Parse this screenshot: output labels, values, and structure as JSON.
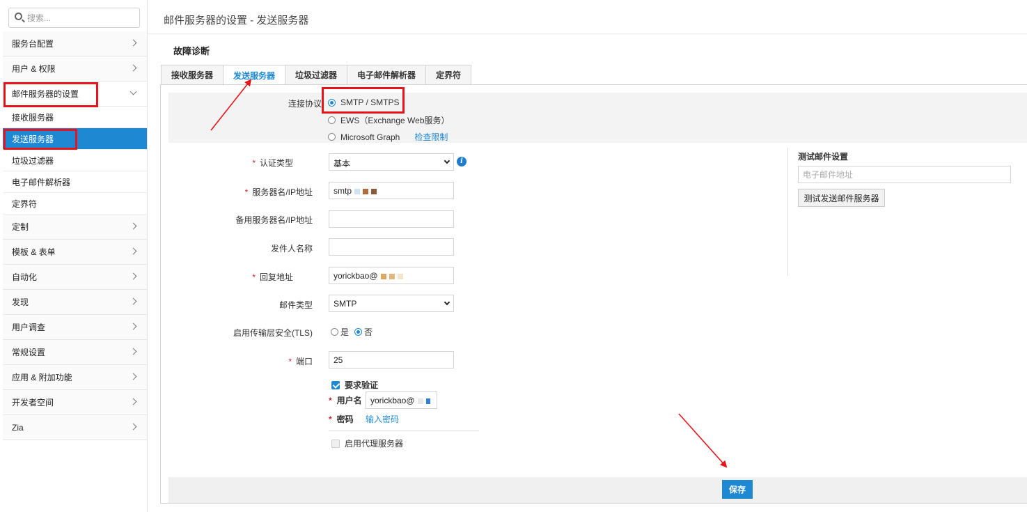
{
  "search": {
    "placeholder": "搜索..."
  },
  "sidebar": {
    "items_top": [
      {
        "label": "服务台配置"
      },
      {
        "label": "用户 & 权限"
      }
    ],
    "expanded": {
      "label": "邮件服务器的设置"
    },
    "sub_items": [
      {
        "label": "接收服务器"
      },
      {
        "label": "发送服务器"
      },
      {
        "label": "垃圾过滤器"
      },
      {
        "label": "电子邮件解析器"
      },
      {
        "label": "定界符"
      }
    ],
    "items_bottom": [
      {
        "label": "定制"
      },
      {
        "label": "模板 & 表单"
      },
      {
        "label": "自动化"
      },
      {
        "label": "发现"
      },
      {
        "label": "用户调查"
      },
      {
        "label": "常规设置"
      },
      {
        "label": "应用 & 附加功能"
      },
      {
        "label": "开发者空间"
      },
      {
        "label": "Zia"
      }
    ]
  },
  "header": {
    "title": "邮件服务器的设置 - 发送服务器"
  },
  "diagnostics": {
    "label": "故障诊断"
  },
  "tabs": [
    {
      "label": "接收服务器"
    },
    {
      "label": "发送服务器"
    },
    {
      "label": "垃圾过滤器"
    },
    {
      "label": "电子邮件解析器"
    },
    {
      "label": "定界符"
    }
  ],
  "protocol": {
    "label": "连接协议",
    "options": [
      {
        "label": "SMTP / SMTPS"
      },
      {
        "label": "EWS（Exchange Web服务）"
      },
      {
        "label": "Microsoft Graph"
      }
    ],
    "link": "检查限制"
  },
  "form": {
    "auth_type": {
      "label": "认证类型",
      "value": "基本"
    },
    "server": {
      "label": "服务器名/IP地址",
      "value": "smtp"
    },
    "backup_server": {
      "label": "备用服务器名/IP地址",
      "value": ""
    },
    "sender_name": {
      "label": "发件人名称",
      "value": ""
    },
    "reply_to": {
      "label": "回复地址",
      "value": "yorickbao@"
    },
    "mail_type": {
      "label": "邮件类型",
      "value": "SMTP"
    },
    "tls": {
      "label": "启用传输层安全(TLS)",
      "yes": "是",
      "no": "否"
    },
    "port": {
      "label": "端口",
      "value": "25"
    },
    "require_auth": {
      "label": "要求验证"
    },
    "username": {
      "label": "用户名",
      "value": "yorickbao@"
    },
    "password": {
      "label": "密码",
      "link": "输入密码"
    },
    "proxy": {
      "label": "启用代理服务器"
    }
  },
  "test_panel": {
    "title": "测试邮件设置",
    "email_placeholder": "电子邮件地址",
    "button": "测试发送邮件服务器"
  },
  "footer": {
    "save": "保存"
  },
  "colors": {
    "accent": "#1e88d2",
    "annotation": "#e8141b",
    "required": "#d9232d"
  }
}
